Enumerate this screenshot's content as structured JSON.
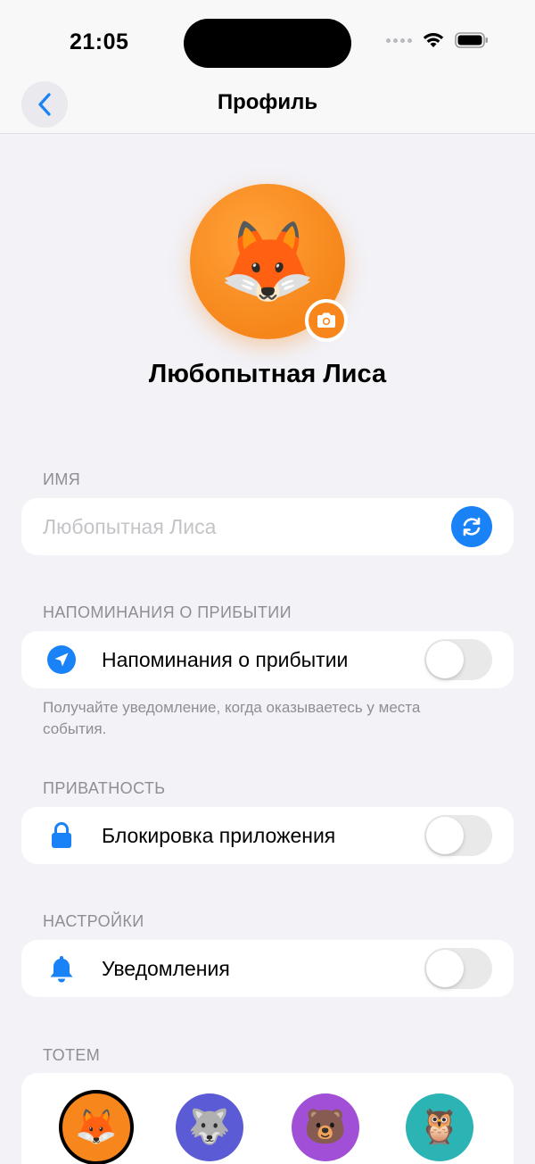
{
  "status_bar": {
    "time": "21:05"
  },
  "nav": {
    "title": "Профиль"
  },
  "profile": {
    "avatar_emoji": "🦊",
    "name": "Любопытная Лиса"
  },
  "name_section": {
    "header": "ИМЯ",
    "placeholder": "Любопытная Лиса",
    "value": ""
  },
  "arrival_section": {
    "header": "НАПОМИНАНИЯ О ПРИБЫТИИ",
    "row_label": "Напоминания о прибытии",
    "toggle_on": false,
    "footnote": "Получайте уведомление, когда оказываетесь у места события."
  },
  "privacy_section": {
    "header": "ПРИВАТНОСТЬ",
    "row_label": "Блокировка приложения",
    "toggle_on": false
  },
  "settings_section": {
    "header": "НАСТРОЙКИ",
    "row_label": "Уведомления",
    "toggle_on": false
  },
  "totem_section": {
    "header": "ТОТЕМ",
    "items": [
      {
        "emoji": "🦊",
        "color": "#f7861c",
        "selected": true
      },
      {
        "emoji": "🐺",
        "color": "#5b5bd6",
        "selected": false
      },
      {
        "emoji": "🐻",
        "color": "#a24fd8",
        "selected": false
      },
      {
        "emoji": "🦉",
        "color": "#2cb3b3",
        "selected": false
      }
    ]
  },
  "colors": {
    "accent": "#1a82f7",
    "avatar": "#f7861c",
    "background": "#f2f2f7"
  }
}
